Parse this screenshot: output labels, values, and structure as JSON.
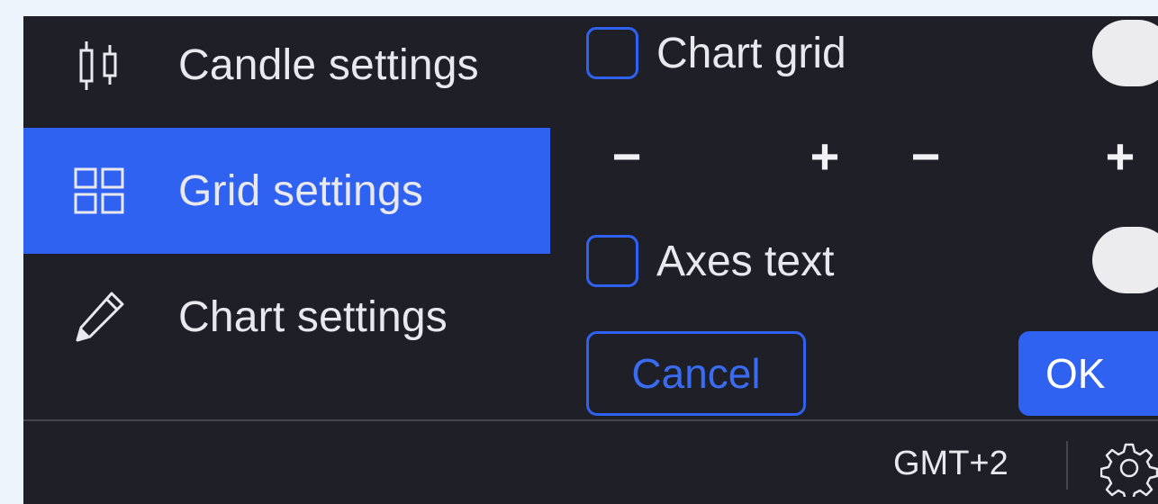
{
  "sidebar": {
    "items": [
      {
        "label": "Candle settings",
        "icon": "candlestick-icon",
        "active": false
      },
      {
        "label": "Grid settings",
        "icon": "grid-icon",
        "active": true
      },
      {
        "label": "Chart settings",
        "icon": "pencil-icon",
        "active": false
      }
    ]
  },
  "grid_panel": {
    "chart_grid_label": "Chart grid",
    "chart_grid_checked": false,
    "axes_text_label": "Axes text",
    "axes_text_checked": false,
    "stepper_minus": "−",
    "stepper_plus": "+",
    "cancel_label": "Cancel",
    "ok_label": "OK"
  },
  "footer": {
    "timezone": "GMT+2",
    "settings_icon": "gear-icon"
  },
  "colors": {
    "background": "#1f1f28",
    "accent": "#2f62f0",
    "text": "#e8e8ee",
    "toggle_knob": "#ecebee",
    "page_bg": "#eef4fb"
  }
}
